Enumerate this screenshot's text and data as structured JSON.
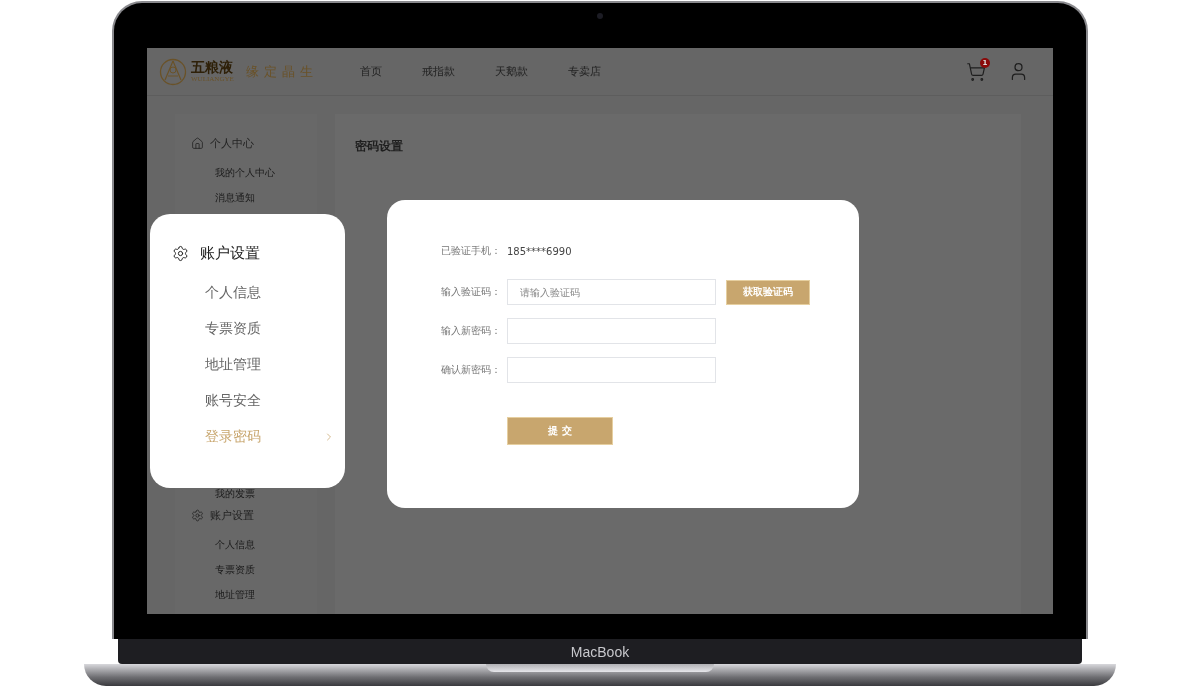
{
  "device": {
    "brand": "MacBook"
  },
  "header": {
    "logo": {
      "name": "五粮液",
      "latin": "WULIANGYE"
    },
    "slogan": "缘定晶生",
    "nav": [
      {
        "label": "首页",
        "selected": false
      },
      {
        "label": "戒指款",
        "selected": false
      },
      {
        "label": "天鹅款",
        "selected": false
      },
      {
        "label": "专卖店",
        "selected": false
      }
    ],
    "cart": {
      "count": "1"
    }
  },
  "sidebar": {
    "entries": [
      {
        "kind": "heading",
        "label": "个人中心"
      },
      {
        "kind": "item",
        "label": "我的个人中心"
      },
      {
        "kind": "item",
        "label": "消息通知"
      },
      {
        "kind": "gap"
      },
      {
        "kind": "item",
        "label": "我的发票"
      },
      {
        "kind": "heading",
        "label": "账户设置"
      },
      {
        "kind": "item",
        "label": "个人信息"
      },
      {
        "kind": "item",
        "label": "专票资质"
      },
      {
        "kind": "item",
        "label": "地址管理"
      }
    ]
  },
  "main": {
    "title": "密码设置"
  },
  "menu_popup": {
    "title": "账户设置",
    "items": [
      {
        "label": "个人信息",
        "selected": false
      },
      {
        "label": "专票资质",
        "selected": false
      },
      {
        "label": "地址管理",
        "selected": false
      },
      {
        "label": "账号安全",
        "selected": false
      },
      {
        "label": "登录密码",
        "selected": true
      }
    ]
  },
  "dialog": {
    "rows": [
      {
        "kind": "text",
        "label": "已验证手机：",
        "value": "185****6990"
      },
      {
        "kind": "input",
        "label": "输入验证码：",
        "placeholder": "请输入验证码",
        "button": "获取验证码"
      },
      {
        "kind": "input",
        "label": "输入新密码："
      },
      {
        "kind": "input",
        "label": "确认新密码："
      }
    ],
    "submit": "提 交"
  }
}
